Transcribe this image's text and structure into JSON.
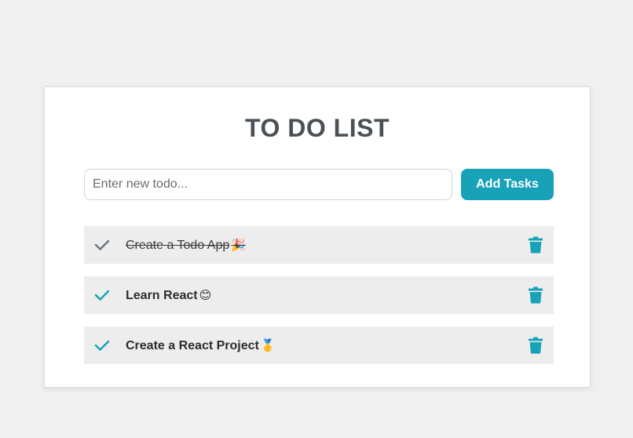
{
  "title": "TO DO LIST",
  "input": {
    "placeholder": "Enter new todo...",
    "value": ""
  },
  "add_button_label": "Add Tasks",
  "colors": {
    "accent": "#17a2b8",
    "done_check": "#6c757d",
    "item_bg": "#ededed"
  },
  "todos": [
    {
      "text": "Create a Todo App",
      "emoji": "🎉",
      "completed": true
    },
    {
      "text": "Learn React",
      "emoji": "😊",
      "completed": false
    },
    {
      "text": "Create a React Project",
      "emoji": "🥇",
      "completed": false
    }
  ]
}
